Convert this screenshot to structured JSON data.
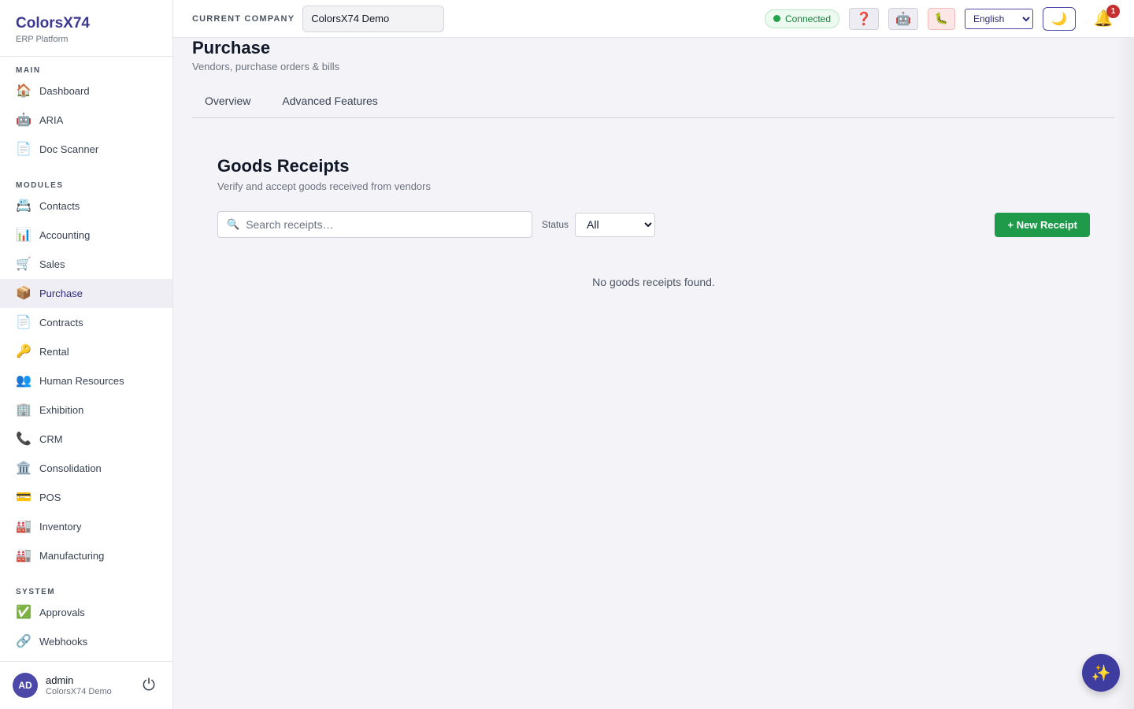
{
  "brand": {
    "title": "ColorsX74",
    "subtitle": "ERP Platform"
  },
  "sidebar": {
    "sections": [
      {
        "label": "MAIN",
        "items": [
          {
            "label": "Dashboard",
            "icon": "🏠"
          },
          {
            "label": "ARIA",
            "icon": "🤖"
          },
          {
            "label": "Doc Scanner",
            "icon": "📄"
          }
        ]
      },
      {
        "label": "MODULES",
        "items": [
          {
            "label": "Contacts",
            "icon": "📇"
          },
          {
            "label": "Accounting",
            "icon": "📊"
          },
          {
            "label": "Sales",
            "icon": "🛒"
          },
          {
            "label": "Purchase",
            "icon": "📦"
          },
          {
            "label": "Contracts",
            "icon": "📄"
          },
          {
            "label": "Rental",
            "icon": "🔑"
          },
          {
            "label": "Human Resources",
            "icon": "👥"
          },
          {
            "label": "Exhibition",
            "icon": "🏢"
          },
          {
            "label": "CRM",
            "icon": "📞"
          },
          {
            "label": "Consolidation",
            "icon": "🏛️"
          },
          {
            "label": "POS",
            "icon": "💳"
          },
          {
            "label": "Inventory",
            "icon": "🏭"
          },
          {
            "label": "Manufacturing",
            "icon": "🏭"
          }
        ]
      },
      {
        "label": "SYSTEM",
        "items": [
          {
            "label": "Approvals",
            "icon": "✅"
          },
          {
            "label": "Webhooks",
            "icon": "🔗"
          }
        ]
      }
    ],
    "active": "Purchase"
  },
  "user": {
    "initials": "AD",
    "name": "admin",
    "company": "ColorsX74 Demo",
    "logout_icon": "⏻"
  },
  "topbar": {
    "company_label": "CURRENT COMPANY",
    "company_value": "ColorsX74 Demo",
    "connection_status": "Connected",
    "help_icon": "❓",
    "robot_icon": "🤖",
    "bug_icon": "🐛",
    "language": "English",
    "theme_icon": "🌙",
    "bell_icon": "🔔",
    "notification_count": "1",
    "colors": {
      "connected": "#22a34a",
      "badge": "#c53030"
    }
  },
  "page": {
    "title": "Purchase",
    "subtitle": "Vendors, purchase orders & bills",
    "tabs": [
      "Overview",
      "Advanced Features"
    ]
  },
  "receipts": {
    "title": "Goods Receipts",
    "subtitle": "Verify and accept goods received from vendors",
    "search_icon": "🔍",
    "search_placeholder": "Search receipts…",
    "status_label": "Status",
    "status_value": "All",
    "new_button": "+ New Receipt",
    "empty_message": "No goods receipts found.",
    "colors": {
      "new_button": "#1f9a4a"
    }
  },
  "fab": {
    "icon": "✨",
    "color": "#3f3ca0"
  }
}
